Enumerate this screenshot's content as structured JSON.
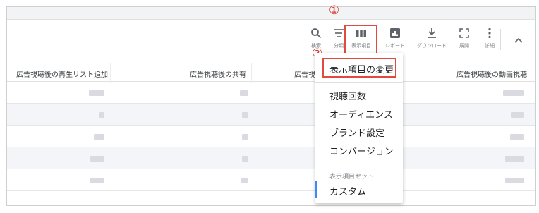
{
  "markers": {
    "first": "①",
    "second": "②"
  },
  "toolbar": {
    "search_label": "検索",
    "segment_label": "分類",
    "columns_label": "表示項目",
    "reports_label": "レポート",
    "download_label": "ダウンロード",
    "expand_label": "展開",
    "more_label": "詳細",
    "active_color": "#5f6368",
    "disabled_color": "#9aa0a6"
  },
  "table": {
    "headers": {
      "col1": "広告視聴後の再生リスト追加",
      "col2": "広告視聴後の共有",
      "col3": "広告視",
      "col4": "広告視聴後の動画視聴"
    },
    "row_count": 5
  },
  "columns_menu": {
    "modify_columns": "表示項目の変更",
    "items": [
      "視聴回数",
      "オーディエンス",
      "ブランド設定",
      "コンバージョン"
    ],
    "section_header": "表示項目セット",
    "saved_set": "カスタム",
    "highlight_color": "#e04a3f",
    "active_indicator_color": "#4285f4"
  }
}
